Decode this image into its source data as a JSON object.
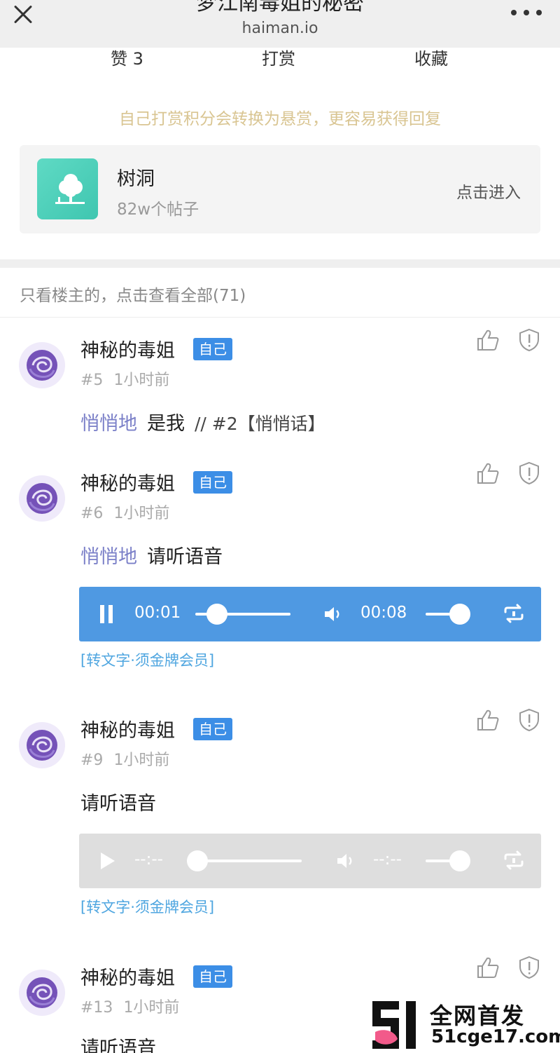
{
  "nav": {
    "title": "梦江南毒姐的秘密",
    "domain": "haiman.io"
  },
  "actions": {
    "like": "赞 3",
    "reward": "打赏",
    "favorite": "收藏"
  },
  "tip": "自己打赏积分会转换为悬赏，更容易获得回复",
  "tree_card": {
    "name": "树洞",
    "count": "82w个帖子",
    "enter": "点击进入"
  },
  "filter": "只看楼主的，点击查看全部(71)",
  "colors": {
    "accent": "#3c8ee6",
    "player_active": "#4f99e2",
    "player_inactive": "#dedede",
    "tip": "#d9c592",
    "whisper": "#7b80c8",
    "tree_logo": "#4fcfb9"
  },
  "posts": [
    {
      "author": "神秘的毒姐",
      "badge": "自己",
      "floor": "#5",
      "time": "1小时前",
      "whisper": "悄悄地",
      "text": "是我",
      "quote": "// #2【悄悄话】"
    },
    {
      "author": "神秘的毒姐",
      "badge": "自己",
      "floor": "#6",
      "time": "1小时前",
      "whisper": "悄悄地",
      "text": "请听语音",
      "player": {
        "state": "playing",
        "current": "00:01",
        "duration": "00:08",
        "progress": 0.12,
        "volume": 0.85
      },
      "transcribe": "[转文字·须金牌会员]"
    },
    {
      "author": "神秘的毒姐",
      "badge": "自己",
      "floor": "#9",
      "time": "1小时前",
      "text": "请听语音",
      "player": {
        "state": "idle",
        "current": "--:--",
        "duration": "--:--",
        "progress": 0.0,
        "volume": 0.85
      },
      "transcribe": "[转文字·须金牌会员]"
    },
    {
      "author": "神秘的毒姐",
      "badge": "自己",
      "floor": "#13",
      "time": "1小时前",
      "text": "请听语音"
    }
  ],
  "watermark": {
    "top": "全网首发",
    "bottom": "51cge17.com"
  },
  "icons": [
    "close-icon",
    "more-icon",
    "tree-icon",
    "avatar-rose-icon",
    "thumbs-up-icon",
    "shield-icon",
    "pause-icon",
    "play-icon",
    "volume-icon",
    "loop-icon"
  ]
}
